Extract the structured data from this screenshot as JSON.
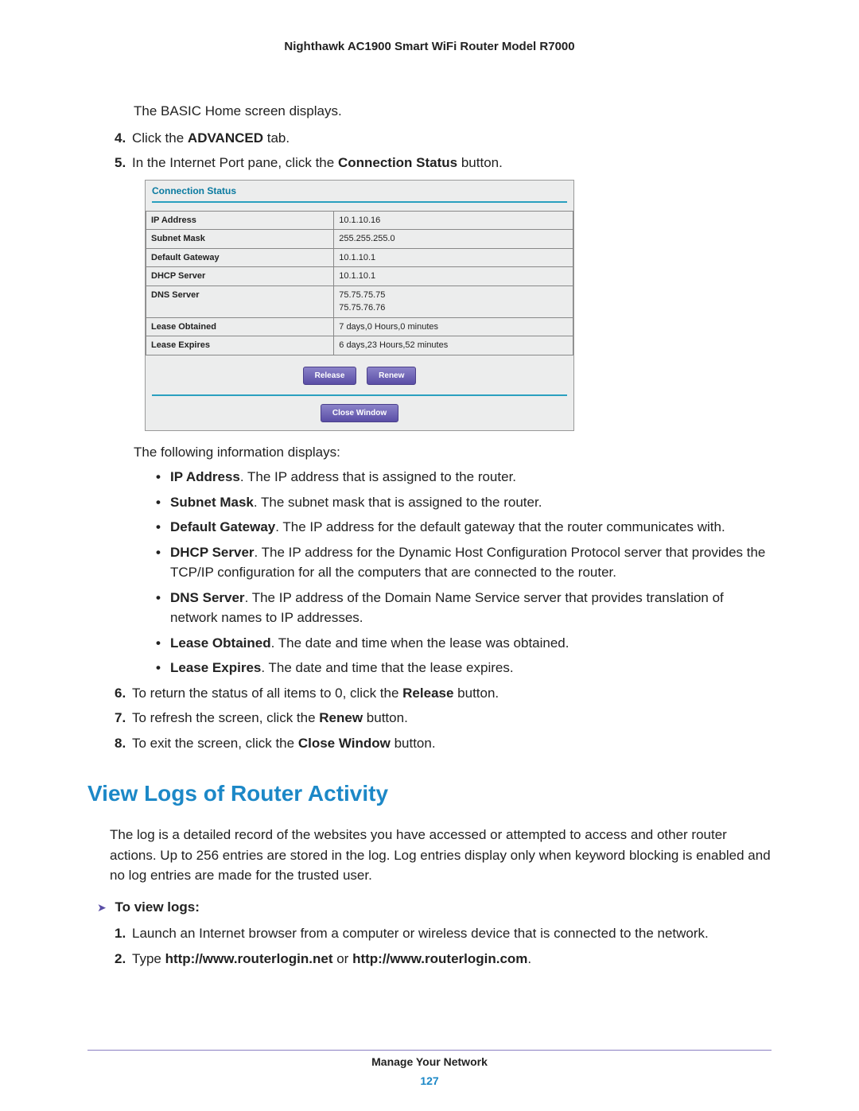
{
  "header": {
    "title": "Nighthawk AC1900 Smart WiFi Router Model R7000"
  },
  "intro": "The BASIC Home screen displays.",
  "steps_a": [
    {
      "num": "4.",
      "pre": "Click the ",
      "bold": "ADVANCED",
      "post": " tab."
    },
    {
      "num": "5.",
      "pre": "In the Internet Port pane, click the ",
      "bold": "Connection Status",
      "post": " button."
    }
  ],
  "screenshot": {
    "title": "Connection Status",
    "rows": [
      {
        "label": "IP Address",
        "value": "10.1.10.16"
      },
      {
        "label": "Subnet Mask",
        "value": "255.255.255.0"
      },
      {
        "label": "Default Gateway",
        "value": "10.1.10.1"
      },
      {
        "label": "DHCP Server",
        "value": "10.1.10.1"
      },
      {
        "label": "DNS Server",
        "value": "75.75.75.75\n75.75.76.76"
      },
      {
        "label": "Lease Obtained",
        "value": "7 days,0 Hours,0 minutes"
      },
      {
        "label": "Lease Expires",
        "value": "6 days,23 Hours,52 minutes"
      }
    ],
    "buttons": {
      "release": "Release",
      "renew": "Renew",
      "close": "Close Window"
    }
  },
  "info_intro": "The following information displays:",
  "bullets": [
    {
      "bold": "IP Address",
      "text": ". The IP address that is assigned to the router."
    },
    {
      "bold": "Subnet Mask",
      "text": ". The subnet mask that is assigned to the router."
    },
    {
      "bold": "Default Gateway",
      "text": ". The IP address for the default gateway that the router communicates with."
    },
    {
      "bold": "DHCP Server",
      "text": ". The IP address for the Dynamic Host Configuration Protocol server that provides the TCP/IP configuration for all the computers that are connected to the router."
    },
    {
      "bold": "DNS Server",
      "text": ". The IP address of the Domain Name Service server that provides translation of network names to IP addresses."
    },
    {
      "bold": "Lease Obtained",
      "text": ". The date and time when the lease was obtained."
    },
    {
      "bold": "Lease Expires",
      "text": ". The date and time that the lease expires."
    }
  ],
  "steps_b": [
    {
      "num": "6.",
      "pre": "To return the status of all items to 0, click the ",
      "bold": "Release",
      "post": " button."
    },
    {
      "num": "7.",
      "pre": "To refresh the screen, click the ",
      "bold": "Renew",
      "post": " button."
    },
    {
      "num": "8.",
      "pre": "To exit the screen, click the ",
      "bold": "Close Window",
      "post": " button."
    }
  ],
  "h2": "View Logs of Router Activity",
  "logs_para": "The log is a detailed record of the websites you have accessed or attempted to access and other router actions. Up to 256 entries are stored in the log. Log entries display only when keyword blocking is enabled and no log entries are made for the trusted user.",
  "sub_head": "To view logs:",
  "logs_steps": [
    {
      "num": "1.",
      "text": "Launch an Internet browser from a computer or wireless device that is connected to the network."
    },
    {
      "num": "2.",
      "pre": "Type ",
      "bold1": "http://www.routerlogin.net",
      "mid": " or ",
      "bold2": "http://www.routerlogin.com",
      "post": "."
    }
  ],
  "footer": {
    "section": "Manage Your Network",
    "page": "127"
  }
}
